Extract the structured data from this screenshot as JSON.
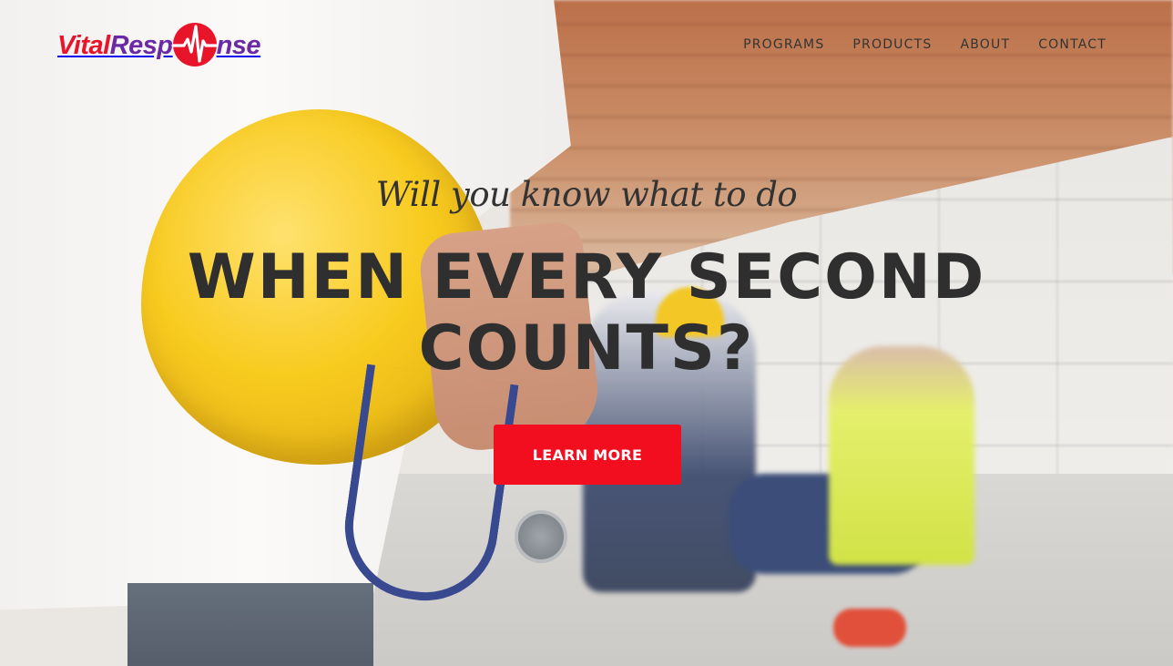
{
  "brand": {
    "logo_part1": "Vital",
    "logo_part2": "Resp",
    "logo_part3": "nse",
    "logo_mark_icon": "heartbeat-circle-icon",
    "colors": {
      "red": "#e8142a",
      "purple": "#6b2aa3"
    }
  },
  "nav": {
    "items": [
      {
        "label": "PROGRAMS"
      },
      {
        "label": "PRODUCTS"
      },
      {
        "label": "ABOUT"
      },
      {
        "label": "CONTACT"
      }
    ]
  },
  "hero": {
    "tagline": "Will you know what to do",
    "headline": "WHEN EVERY SECOND COUNTS?",
    "cta_label": "LEARN MORE",
    "cta_color": "#f20d1f"
  }
}
